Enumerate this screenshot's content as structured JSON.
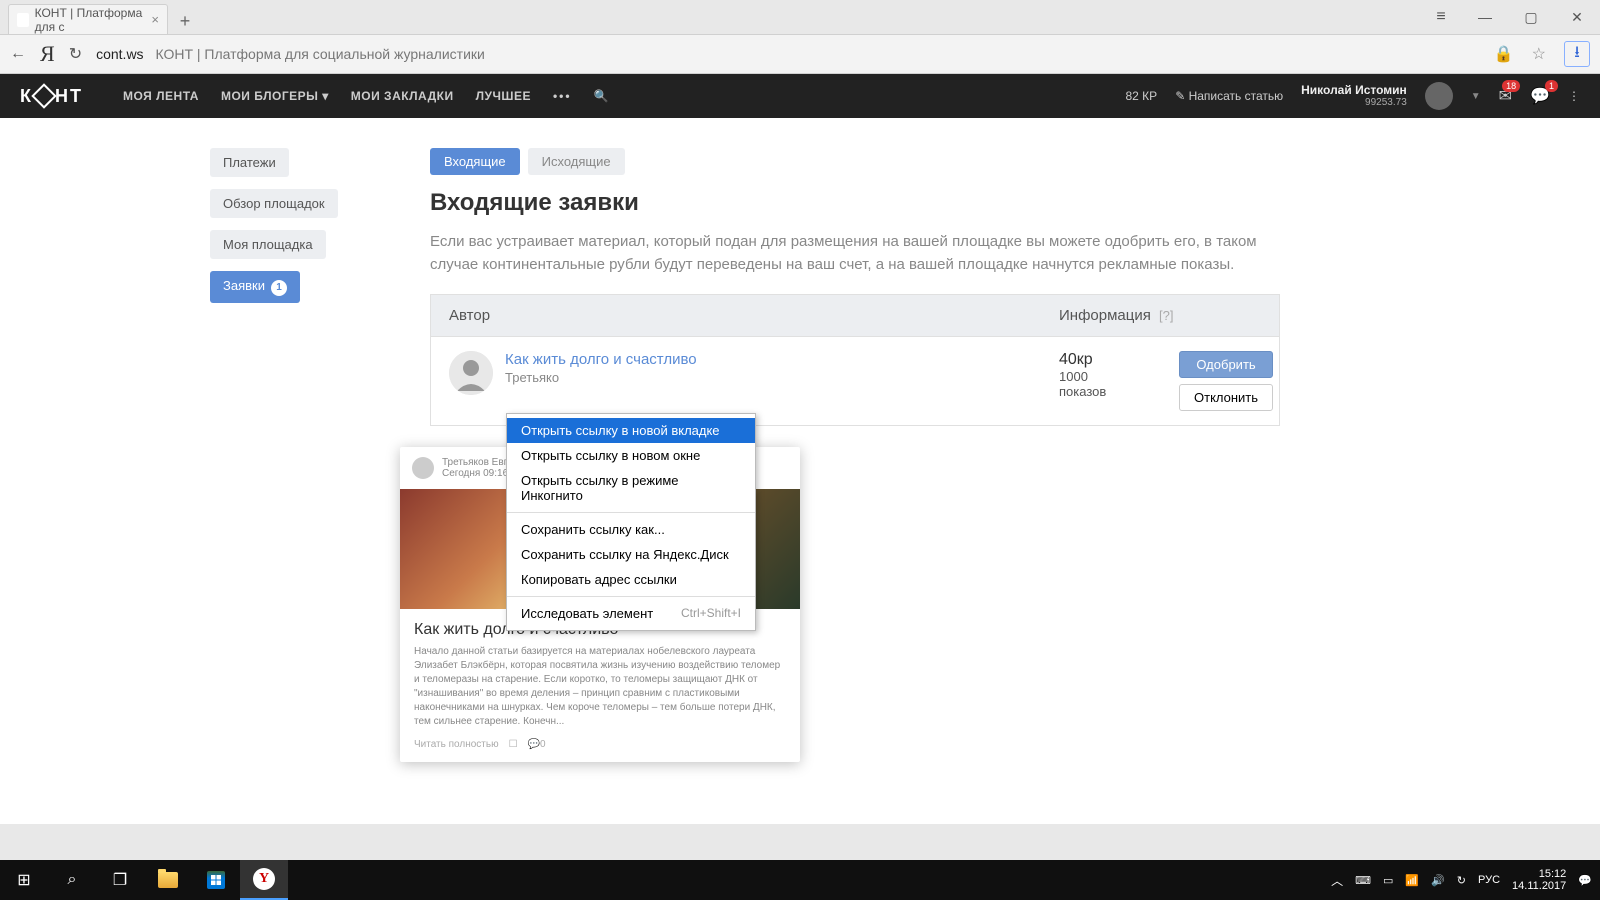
{
  "browser": {
    "tab_title": "КОНТ | Платформа для с",
    "url_domain": "cont.ws",
    "url_title": "КОНТ | Платформа для социальной журналистики"
  },
  "header": {
    "nav": {
      "feed": "МОЯ ЛЕНТА",
      "bloggers": "МОИ БЛОГЕРЫ",
      "bookmarks": "МОИ ЗАКЛАДКИ",
      "best": "ЛУЧШЕЕ"
    },
    "kr": "82 КР",
    "write": "Написать статью",
    "user_name": "Николай Истомин",
    "user_balance": "99253.73",
    "badge_msg": "18",
    "badge_notif": "1"
  },
  "sidebar": {
    "payments": "Платежи",
    "overview": "Обзор площадок",
    "my": "Моя площадка",
    "requests": "Заявки",
    "requests_count": "1"
  },
  "tabs": {
    "in": "Входящие",
    "out": "Исходящие"
  },
  "page": {
    "title": "Входящие заявки",
    "desc": "Если вас устраивает материал, который подан для размещения на вашей площадке вы можете одобрить его, в таком случае континентальные рубли будут переведены на ваш счет, а на вашей площадке начнутся рекламные показы.",
    "col_author": "Автор",
    "col_info": "Информация",
    "col_q": "[?]"
  },
  "row": {
    "title": "Как жить долго и счастливо",
    "author": "Третьяко",
    "kr": "40кр",
    "shows": "1000",
    "shows_label": "показов",
    "approve": "Одобрить",
    "reject": "Отклонить"
  },
  "card": {
    "author": "Третьяков Евгений",
    "date": "Сегодня 09:16",
    "title": "Как жить долго и счастливо",
    "text": "Начало данной статьи базируется на материалах нобелевского лауреата Элизабет Блэкбёрн, которая посвятила жизнь изучению воздействию теломер и теломеразы на старение. Если коротко, то теломеры защищают ДНК от \"изнашивания\" во время деления – принцип сравним с пластиковыми наконечниками на шнурках. Чем короче теломеры – тем больше потери ДНК, тем сильнее старение. Конечн...",
    "read": "Читать полностью",
    "c0": "0"
  },
  "ctx": {
    "new_tab": "Открыть ссылку в новой вкладке",
    "new_win": "Открыть ссылку в новом окне",
    "incognito": "Открыть ссылку в режиме Инкогнито",
    "save_as": "Сохранить ссылку как...",
    "save_yd": "Сохранить ссылку на Яндекс.Диск",
    "copy": "Копировать адрес ссылки",
    "inspect": "Исследовать элемент",
    "inspect_sc": "Ctrl+Shift+I"
  },
  "taskbar": {
    "lang": "РУС",
    "time": "15:12",
    "date": "14.11.2017"
  }
}
